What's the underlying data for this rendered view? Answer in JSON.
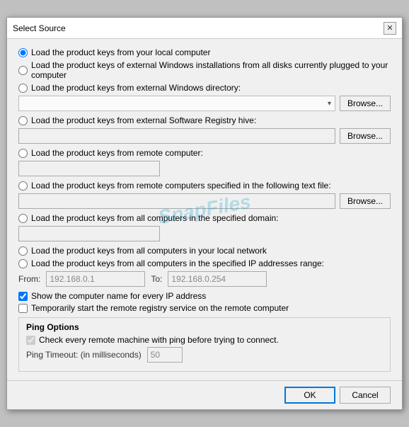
{
  "dialog": {
    "title": "Select Source",
    "close_label": "✕"
  },
  "options": [
    {
      "id": "opt1",
      "label": "Load the product keys from your local computer",
      "checked": true
    },
    {
      "id": "opt2",
      "label": "Load the product keys of external Windows installations from all disks currently plugged to your computer",
      "checked": false
    },
    {
      "id": "opt3",
      "label": "Load the product keys from external Windows directory:",
      "checked": false
    },
    {
      "id": "opt4",
      "label": "Load the product keys from external Software Registry hive:",
      "checked": false
    },
    {
      "id": "opt5",
      "label": "Load the product keys from remote computer:",
      "checked": false
    },
    {
      "id": "opt6",
      "label": "Load the product keys from remote computers specified in the following text file:",
      "checked": false
    },
    {
      "id": "opt7",
      "label": "Load the product keys from all computers in the specified domain:",
      "checked": false
    },
    {
      "id": "opt8",
      "label": "Load the product keys from all computers in your local network",
      "checked": false
    },
    {
      "id": "opt9",
      "label": "Load the product keys from all computers in the specified IP addresses range:",
      "checked": false
    }
  ],
  "browse_label": "Browse...",
  "from_label": "From:",
  "to_label": "To:",
  "from_value": "192.168.0.1",
  "to_value": "192.168.0.254",
  "checkboxes": [
    {
      "id": "cb1",
      "label": "Show the computer name for every IP address",
      "checked": true,
      "disabled": false
    },
    {
      "id": "cb2",
      "label": "Temporarily start the remote registry service on the remote computer",
      "checked": false,
      "disabled": false
    }
  ],
  "ping_section": {
    "title": "Ping Options",
    "items": [
      {
        "id": "cb3",
        "label": "Check every remote machine with ping before trying to connect.",
        "checked": true,
        "disabled": true
      }
    ],
    "timeout_label": "Ping Timeout: (in milliseconds)",
    "timeout_value": "50"
  },
  "footer": {
    "ok_label": "OK",
    "cancel_label": "Cancel"
  },
  "watermark": "SnapFiles"
}
